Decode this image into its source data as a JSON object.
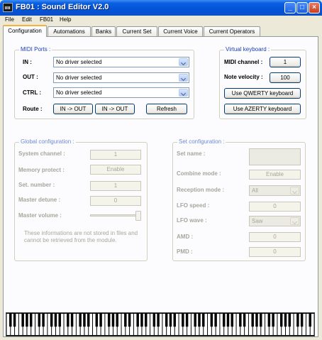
{
  "window": {
    "title": "FB01 : Sound Editor V2.0",
    "controls": {
      "minimize": "_",
      "maximize": "□",
      "close": "×"
    }
  },
  "menu": [
    "File",
    "Edit",
    "FB01",
    "Help"
  ],
  "tabs": [
    "Configuration",
    "Automations",
    "Banks",
    "Current Set",
    "Current Voice",
    "Current Operators"
  ],
  "active_tab": "Configuration",
  "midi_ports": {
    "title": "MIDI Ports :",
    "in_label": "IN :",
    "in_value": "No driver selected",
    "out_label": "OUT :",
    "out_value": "No driver selected",
    "ctrl_label": "CTRL :",
    "ctrl_value": "No driver selected",
    "route_label": "Route :",
    "route_btn1": "IN -> OUT",
    "route_btn2": "IN -> OUT",
    "refresh": "Refresh"
  },
  "virtual_keyboard": {
    "title": "Virtual keyboard :",
    "channel_label": "MIDI channel :",
    "channel_value": "1",
    "velocity_label": "Note velocity :",
    "velocity_value": "100",
    "qwerty": "Use QWERTY keyboard",
    "azerty": "Use AZERTY keyboard"
  },
  "global_config": {
    "title": "Global configuration :",
    "system_channel_label": "System channel :",
    "system_channel_value": "1",
    "memory_protect_label": "Memory protect :",
    "memory_protect_value": "Enable",
    "set_number_label": "Set. number :",
    "set_number_value": "1",
    "master_detune_label": "Master detune :",
    "master_detune_value": "0",
    "master_volume_label": "Master volume :",
    "master_volume_level": 1.0,
    "note": "These informations are not stored in files and cannot be retrieved from the module."
  },
  "set_config": {
    "title": "Set configuration :",
    "set_name_label": "Set name :",
    "set_name_value": "",
    "combine_mode_label": "Combine mode :",
    "combine_mode_value": "Enable",
    "reception_mode_label": "Reception mode :",
    "reception_mode_value": "All",
    "lfo_speed_label": "LFO speed :",
    "lfo_speed_value": "0",
    "lfo_wave_label": "LFO wave :",
    "lfo_wave_value": "Saw",
    "amd_label": "AMD :",
    "amd_value": "0",
    "pmd_label": "PMD :",
    "pmd_value": "0"
  },
  "colors": {
    "titlebar": "#0a5fe0",
    "group_title": "#1c40b8",
    "disabled_text": "#a7a69b",
    "tab_active_highlight": "#f2b23c"
  }
}
